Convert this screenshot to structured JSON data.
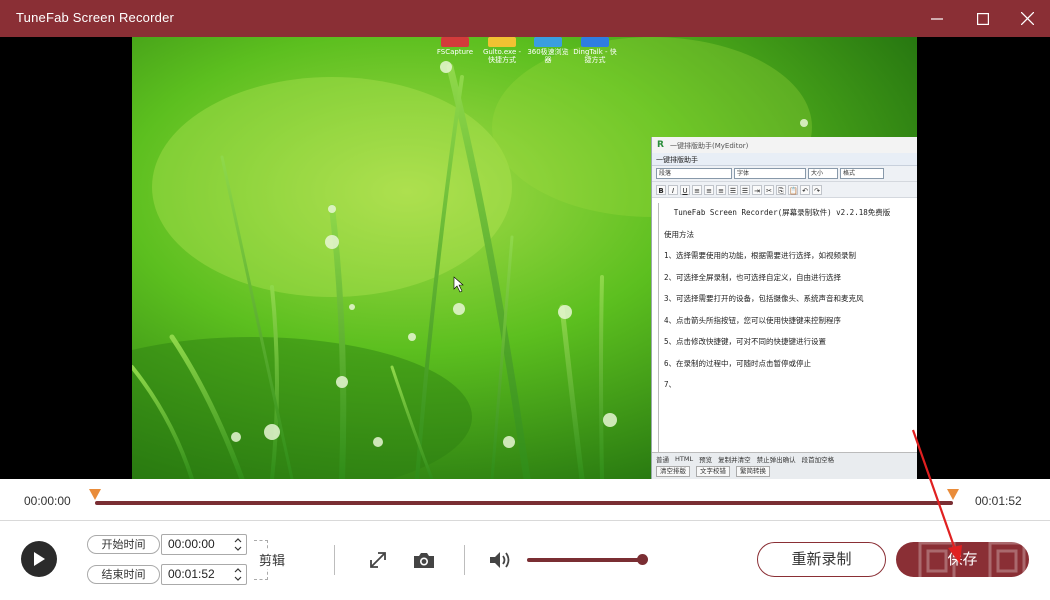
{
  "window": {
    "title": "TuneFab Screen Recorder",
    "title_bar_color": "#8a2f35"
  },
  "desktop_icons": [
    {
      "label": "FSCapture",
      "color": "#d23b3b"
    },
    {
      "label": "Gulto.exe - 快捷方式",
      "color": "#f1c232"
    },
    {
      "label": "360极速浏览器",
      "color": "#3a9ee0"
    },
    {
      "label": "DingTalk - 快捷方式",
      "color": "#2f7de1"
    }
  ],
  "notepad": {
    "title": "一键排版助手(MyEditor)",
    "tab": "一键排版助手",
    "toolbar_selects": [
      "段落",
      "字体",
      "大小",
      "格式"
    ],
    "toolbar_buttons": [
      "B",
      "I",
      "U"
    ],
    "lines": [
      "TuneFab Screen Recorder(屏幕录制软件) v2.2.18免费版",
      "使用方法",
      "1、选择需要使用的功能，根据需要进行选择，如视频录制",
      "2、可选择全屏录制，也可选择自定义，自由进行选择",
      "3、可选择需要打开的设备，包括摄像头、系统声音和麦克风",
      "4、点击箭头所指按钮，您可以使用快捷键来控制程序",
      "5、点击修改快捷键，可对不同的快捷键进行设置",
      "6、在录制的过程中，可随时点击暂停或停止",
      "7、"
    ],
    "footer_row1": [
      "普通",
      "HTML",
      "预览",
      "复制并清空",
      "禁止弹出确认",
      "段首加空格"
    ],
    "footer_row2": [
      "清空排版",
      "文字校错",
      "繁简转换"
    ]
  },
  "timeline": {
    "start_time": "00:00:00",
    "end_time": "00:01:52",
    "accent_color": "#7a2e33"
  },
  "controls": {
    "start_label": "开始时间",
    "start_value": "00:00:00",
    "end_label": "结束时间",
    "end_value": "00:01:52",
    "cut_label": "剪辑",
    "rerecord_label": "重新录制",
    "save_label": "保存"
  }
}
